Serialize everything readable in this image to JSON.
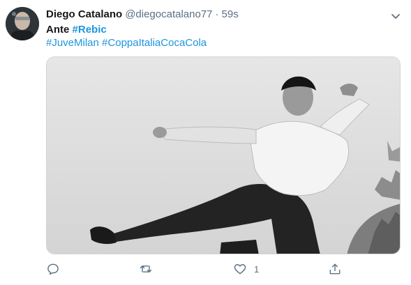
{
  "tweet": {
    "author_name": "Diego Catalano",
    "handle": "@diegocatalano77",
    "separator": "·",
    "time": "59s",
    "text_prefix": "Ante",
    "hashtag_main": "#Rebic",
    "hashtags": [
      "#JuveMilan",
      "#CoppaItaliaCocaCola"
    ],
    "like_count": "1"
  },
  "icons": {
    "menu": "chevron-down-icon",
    "reply": "reply-icon",
    "retweet": "retweet-icon",
    "like": "heart-icon",
    "share": "share-icon"
  },
  "colors": {
    "text": "#14171a",
    "secondary": "#5b7083",
    "link": "#1b95e0"
  }
}
